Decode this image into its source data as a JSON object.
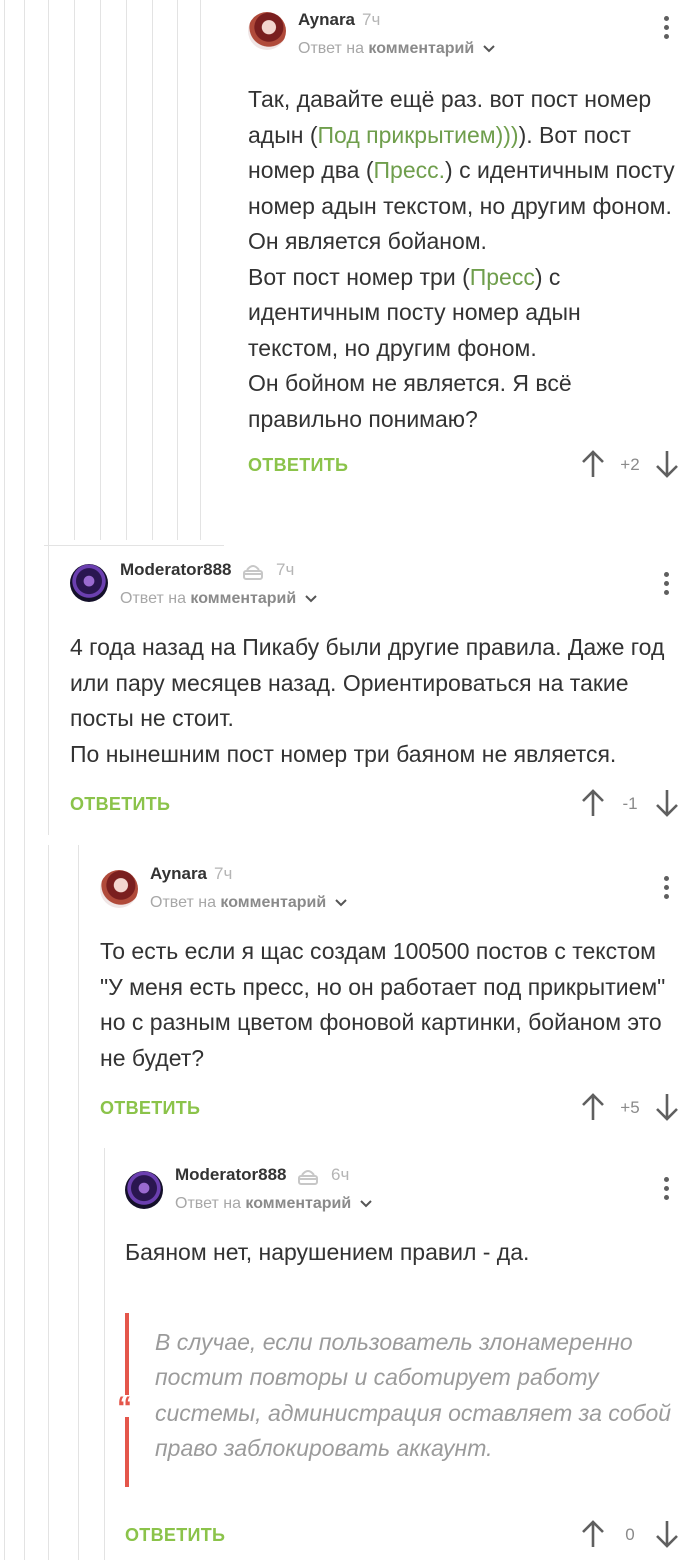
{
  "comments": [
    {
      "author": "Aynara",
      "time": "7ч",
      "reply_prefix": "Ответ на",
      "reply_target": "комментарий",
      "body": {
        "p1_a": "Так, давайте ещё раз. вот пост номер адын  (",
        "p1_link1": "Под прикрытием)))",
        "p1_b": "). Вот пост номер два (",
        "p1_link2": "Пресс.",
        "p1_c": ") с идентичным посту номер адын текстом, но другим фоном. Он является бойаном.",
        "p2_a": "Вот пост номер три (",
        "p2_link": "Пресс",
        "p2_b": ") с идентичным посту номер адын текстом, но другим фоном.",
        "p3": "Он бойном не является. Я всё правильно понимаю?"
      },
      "reply_label": "ОТВЕТИТЬ",
      "score": "+2"
    },
    {
      "author": "Moderator888",
      "time": "7ч",
      "reply_prefix": "Ответ на",
      "reply_target": "комментарий",
      "body": {
        "p1": "4 года назад на Пикабу были другие правила. Даже год или пару месяцев назад. Ориентироваться на такие посты не стоит.",
        "p2": "По нынешним пост номер три баяном не является."
      },
      "reply_label": "ОТВЕТИТЬ",
      "score": "-1"
    },
    {
      "author": "Aynara",
      "time": "7ч",
      "reply_prefix": "Ответ на",
      "reply_target": "комментарий",
      "body": {
        "p1": "То есть если я щас создам 100500 постов с текстом \"У меня есть пресс, но он работает под прикрытием\" но с разным цветом фоновой картинки, бойаном это не будет?"
      },
      "reply_label": "ОТВЕТИТЬ",
      "score": "+5"
    },
    {
      "author": "Moderator888",
      "time": "6ч",
      "reply_prefix": "Ответ на",
      "reply_target": "комментарий",
      "body": {
        "p1": "Баяном нет, нарушением правил - да.",
        "quote": "В случае, если пользователь злонамеренно постит повторы и саботирует работу системы, администрация оставляет за собой право заблокировать аккаунт."
      },
      "reply_label": "ОТВЕТИТЬ",
      "score": "0"
    }
  ],
  "icons": {
    "moderator_badge": "moderator-badge-icon",
    "more": "more-vertical-icon",
    "upvote": "arrow-up-icon",
    "downvote": "arrow-down-icon",
    "quote": "quote-icon"
  },
  "colors": {
    "accent_green": "#8bc34a",
    "link_green": "#6f9e4c",
    "quote_red": "#e4564b",
    "muted_gray": "#a7a7a7"
  }
}
